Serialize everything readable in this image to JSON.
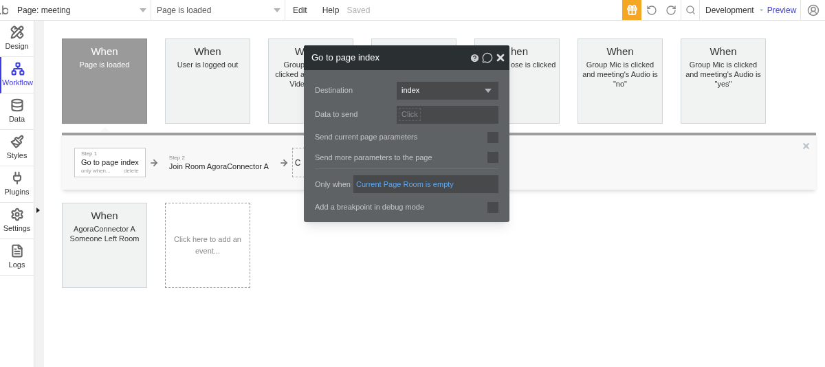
{
  "topbar": {
    "page_selector": "Page: meeting",
    "event_selector": "Page is loaded",
    "menu": [
      "Edit",
      "Help"
    ],
    "status": "Saved",
    "environment": "Development",
    "preview": "Preview"
  },
  "sidebar": {
    "items": [
      {
        "label": "Design",
        "selected": false
      },
      {
        "label": "Workflow",
        "selected": true
      },
      {
        "label": "Data",
        "selected": false
      },
      {
        "label": "Styles",
        "selected": false
      },
      {
        "label": "Plugins",
        "selected": false
      },
      {
        "label": "Settings",
        "selected": false
      },
      {
        "label": "Logs",
        "selected": false
      }
    ]
  },
  "events": [
    {
      "kind": "full",
      "header": "When",
      "text": "Page is loaded",
      "selected": true
    },
    {
      "kind": "full",
      "header": "When",
      "text": "User is logged out",
      "selected": false
    },
    {
      "kind": "covered_right",
      "header": "W",
      "text": "Group\nclicked a\nVide",
      "selected": false
    },
    {
      "kind": "hidden",
      "selected": false
    },
    {
      "kind": "covered_left",
      "header": "hen",
      "text": "ose is clicked",
      "selected": false
    },
    {
      "kind": "full",
      "header": "When",
      "text": "Group Mic is clicked and meeting's Audio is \"no\"",
      "selected": false
    },
    {
      "kind": "full",
      "header": "When",
      "text": "Group Mic is clicked and meeting's Audio is \"yes\"",
      "selected": false
    }
  ],
  "steps": [
    {
      "kind": "action",
      "label": "Step 1",
      "title": "Go to page index",
      "links": [
        "only when...",
        "delete"
      ],
      "selected": true
    },
    {
      "kind": "action",
      "label": "Step 2",
      "title": "Join Room AgoraConnector A",
      "selected": false
    },
    {
      "kind": "add",
      "title": "C"
    }
  ],
  "events_row2": [
    {
      "kind": "full",
      "header": "When",
      "text": "AgoraConnector A Someone Left Room",
      "selected": false
    },
    {
      "kind": "add",
      "text": "Click here to add an event...",
      "selected": false
    }
  ],
  "dialog": {
    "title": "Go to page index",
    "rows": [
      {
        "kind": "select",
        "label": "Destination",
        "value": "index"
      },
      {
        "kind": "input",
        "label": "Data to send",
        "placeholder": "Click"
      },
      {
        "kind": "checkbox",
        "label": "Send current page parameters",
        "checked": false
      },
      {
        "kind": "checkbox",
        "label": "Send more parameters to the page",
        "checked": false
      },
      {
        "kind": "condition",
        "label": "Only when",
        "value": "Current Page Room is empty"
      },
      {
        "kind": "checkbox",
        "label": "Add a breakpoint in debug mode",
        "checked": false
      }
    ]
  }
}
